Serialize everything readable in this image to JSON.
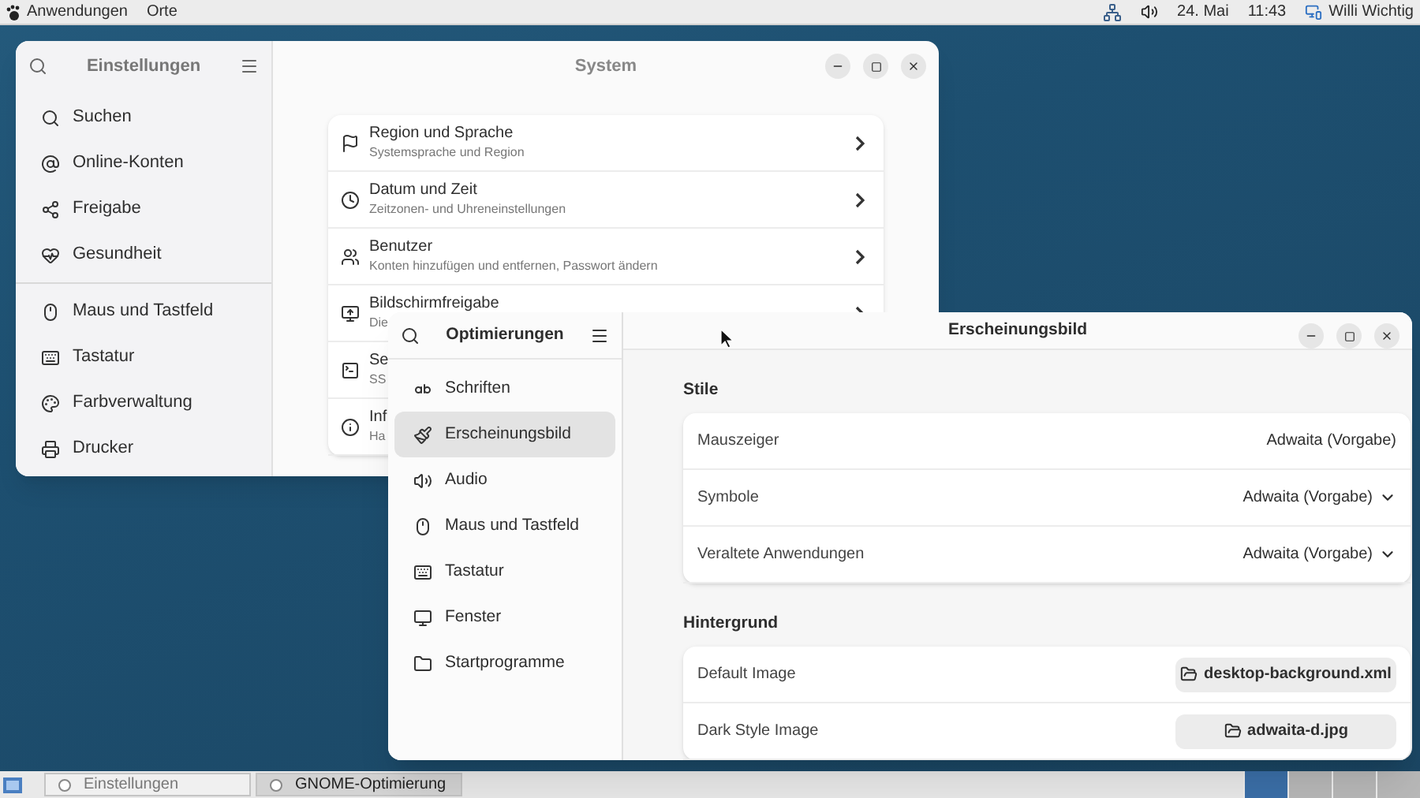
{
  "top_bar": {
    "applications": "Anwendungen",
    "places": "Orte",
    "date": "24. Mai",
    "time": "11:43",
    "user": "Willi Wichtig"
  },
  "settings_window": {
    "sidebar_title": "Einstellungen",
    "title": "System",
    "sidebar_groups": [
      [
        "Suchen",
        "Online-Konten",
        "Freigabe",
        "Gesundheit"
      ],
      [
        "Maus und Tastfeld",
        "Tastatur",
        "Farbverwaltung",
        "Drucker"
      ]
    ],
    "rows": [
      {
        "title": "Region und Sprache",
        "subtitle": "Systemsprache und Region"
      },
      {
        "title": "Datum und Zeit",
        "subtitle": "Zeitzonen- und Uhreneinstellungen"
      },
      {
        "title": "Benutzer",
        "subtitle": "Konten hinzufügen und entfernen, Passwort ändern"
      },
      {
        "title": "Bildschirmfreigabe",
        "subtitle": "Die"
      },
      {
        "title": "Se",
        "subtitle": "SS"
      },
      {
        "title": "Inf",
        "subtitle": "Ha"
      }
    ]
  },
  "tweaks_window": {
    "sidebar_title": "Optimierungen",
    "title": "Erscheinungsbild",
    "sidebar_items": [
      {
        "label": "Schriften",
        "selected": false
      },
      {
        "label": "Erscheinungsbild",
        "selected": true
      },
      {
        "label": "Audio",
        "selected": false
      },
      {
        "label": "Maus und Tastfeld",
        "selected": false
      },
      {
        "label": "Tastatur",
        "selected": false
      },
      {
        "label": "Fenster",
        "selected": false
      },
      {
        "label": "Startprogramme",
        "selected": false
      }
    ],
    "sections": [
      {
        "heading": "Stile",
        "rows": [
          {
            "kind": "text",
            "label": "Mauszeiger",
            "value": "Adwaita (Vorgabe)"
          },
          {
            "kind": "dropdown",
            "label": "Symbole",
            "value": "Adwaita (Vorgabe)"
          },
          {
            "kind": "dropdown",
            "label": "Veraltete Anwendungen",
            "value": "Adwaita (Vorgabe)"
          }
        ]
      },
      {
        "heading": "Hintergrund",
        "rows": [
          {
            "kind": "file",
            "label": "Default Image",
            "value": "desktop-background.xml"
          },
          {
            "kind": "file",
            "label": "Dark Style Image",
            "value": "adwaita-d.jpg"
          }
        ]
      }
    ]
  },
  "taskbar": {
    "windows": [
      {
        "label": "Einstellungen",
        "active": false
      },
      {
        "label": "GNOME-Optimierung",
        "active": true
      }
    ],
    "workspaces": [
      {
        "selected": true
      },
      {
        "selected": false
      },
      {
        "selected": false
      },
      {
        "selected": false
      }
    ]
  }
}
